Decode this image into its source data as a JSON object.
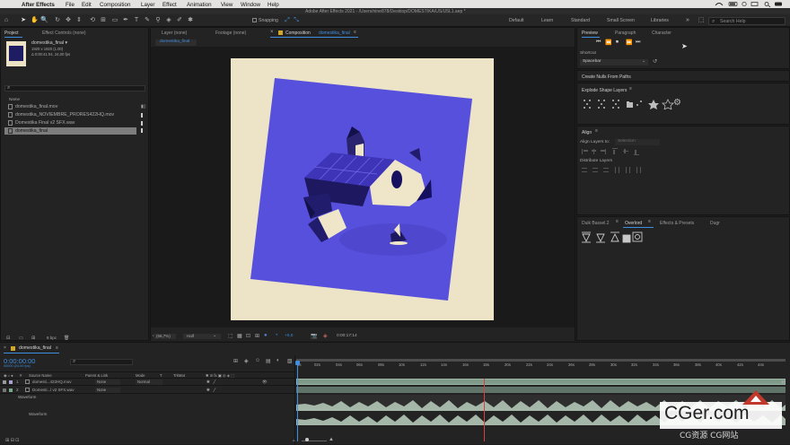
{
  "menubar": {
    "apple": "",
    "items": [
      "After Effects",
      "File",
      "Edit",
      "Composition",
      "Layer",
      "Effect",
      "Animation",
      "View",
      "Window",
      "Help"
    ]
  },
  "app": {
    "window_title": "Adobe After Effects 2021 - /Users/nine878/Desktop/DOMESTIKA/US/U5L1.aep *"
  },
  "toolbar": {
    "snapping": "Snapping",
    "workspaces": [
      "Default",
      "Learn",
      "Standard",
      "Small Screen",
      "Libraries"
    ],
    "search_placeholder": "Search Help"
  },
  "project_panel": {
    "tabs": [
      "Project",
      "Effect Controls (none)"
    ],
    "selected_name": "domestika_final ▾",
    "selected_info_1": "1920 x 1920 (1.00)",
    "selected_info_2": "Δ 0:00:41:04, 24,00 fps",
    "search_placeholder": "",
    "column_name": "Name",
    "items": [
      "domestika_final.mov",
      "domestika_NOVIEMBRE_PRORES422HQ.mov",
      "Domestika Final v2 SFX.wav",
      "domestika_final"
    ],
    "footer_bpc": "8 bpc"
  },
  "viewer_tabs": {
    "layer": "Layer (none)",
    "footage": "Footage (none)",
    "composition_prefix": "Composition",
    "composition_name": "domestika_final",
    "breadcrumb": "domestika_final"
  },
  "viewer_footer": {
    "zoom": "(66,7%)",
    "resolution": "Half",
    "exposure": "+0,0",
    "time": "0:00:17:14"
  },
  "right_panel": {
    "tabs": [
      "Preview",
      "Paragraph",
      "Character"
    ],
    "shortcut_label": "Shortcut",
    "shortcut_value": "Spacebar",
    "create_nulls": "Create Nulls From Paths",
    "explode": "Explode Shape Layers",
    "align_title": "Align",
    "align_to_label": "Align Layers to:",
    "align_to_value": "Selection",
    "distribute": "Distribute Layers",
    "bottom_tabs": [
      "Duik Bassel.2",
      "Overlord",
      "Effects & Presets",
      "Dugr"
    ]
  },
  "timeline": {
    "comp_tab": "domestika_final",
    "timecode": "0:00:00:00",
    "timecode_sub": "00000 (24.00 fps)",
    "columns": [
      "#",
      "Source Name",
      "Parent & Link",
      "Mode",
      "T",
      "TrkMat"
    ],
    "layers": [
      {
        "num": "1",
        "name": "domesti...422HQ.mov",
        "parent": "None",
        "mode": "Normal"
      },
      {
        "num": "2",
        "name": "Domesti...l v2 SFX.wav",
        "parent": "None",
        "mode": ""
      }
    ],
    "waveform_group": "Waveform",
    "waveform_label": "Waveform",
    "ruler": [
      "0s",
      "02s",
      "04s",
      "06s",
      "08s",
      "10s",
      "12s",
      "14s",
      "16s",
      "18s",
      "20s",
      "22s",
      "24s",
      "26s",
      "28s",
      "30s",
      "32s",
      "34s",
      "36s",
      "38s",
      "40s",
      "42s",
      "44s"
    ]
  },
  "watermark": {
    "main": "CGer.com",
    "sub": "CG资源 CG网站"
  },
  "colors": {
    "accent": "#3f8ee0",
    "comp_bg": "#ede3c7",
    "comp_square": "#5750dd",
    "playhead": "#d94040",
    "timebar_green": "#7f9a89"
  }
}
